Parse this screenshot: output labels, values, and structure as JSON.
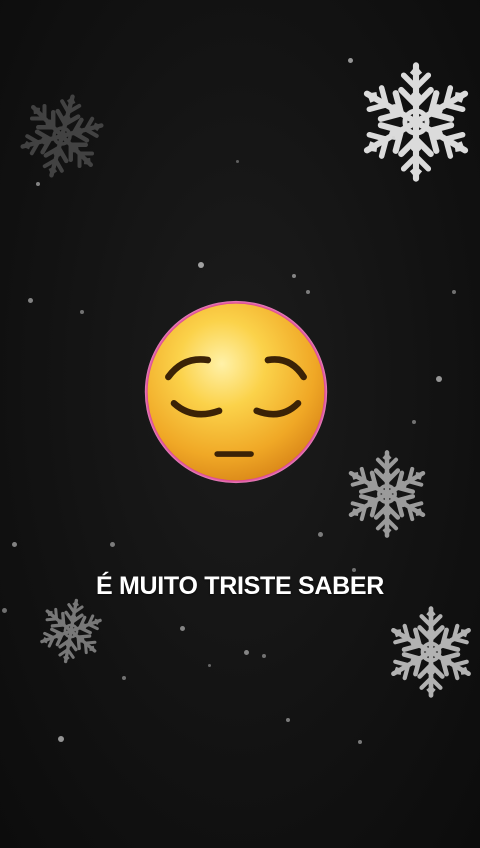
{
  "caption": "É MUITO TRISTE SABER",
  "emoji": "pensive-face",
  "background_color": "#141414",
  "accent_colors": {
    "emoji_yellow": "#f5c542",
    "emoji_rim": "#ff4fa8",
    "snowflake": "#ffffff"
  }
}
